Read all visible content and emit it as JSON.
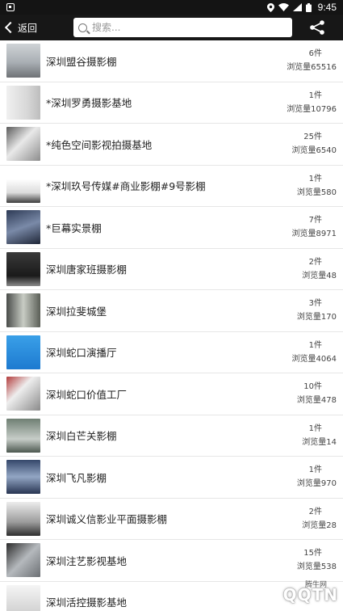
{
  "status_bar": {
    "time": "9:45"
  },
  "header": {
    "back_label": "返回",
    "search_placeholder": "搜索..."
  },
  "items": [
    {
      "title": "深圳盟谷摄影棚",
      "count": "6件",
      "views": "浏览量65516"
    },
    {
      "title": "*深圳罗勇摄影基地",
      "count": "1件",
      "views": "浏览量10796"
    },
    {
      "title": "*纯色空间影视拍摄基地",
      "count": "25件",
      "views": "浏览量6540"
    },
    {
      "title": "*深圳玖号传媒#商业影棚#9号影棚",
      "count": "1件",
      "views": "浏览量580"
    },
    {
      "title": "*巨幕实景棚",
      "count": "7件",
      "views": "浏览量8971"
    },
    {
      "title": "深圳唐家班摄影棚",
      "count": "2件",
      "views": "浏览量48"
    },
    {
      "title": "深圳拉斐城堡",
      "count": "3件",
      "views": "浏览量170"
    },
    {
      "title": "深圳蛇口演播厅",
      "count": "1件",
      "views": "浏览量4064"
    },
    {
      "title": "深圳蛇口价值工厂",
      "count": "10件",
      "views": "浏览量478"
    },
    {
      "title": "深圳白芒关影棚",
      "count": "1件",
      "views": "浏览量14"
    },
    {
      "title": "深圳飞凡影棚",
      "count": "1件",
      "views": "浏览量970"
    },
    {
      "title": "深圳诚义信影业平面摄影棚",
      "count": "2件",
      "views": "浏览量28"
    },
    {
      "title": "深圳注艺影视基地",
      "count": "15件",
      "views": "浏览量538"
    },
    {
      "title": "深圳活控摄影基地",
      "count": "",
      "views": ""
    }
  ],
  "watermark": {
    "logo": "QQTN",
    "small": "腾牛网"
  }
}
